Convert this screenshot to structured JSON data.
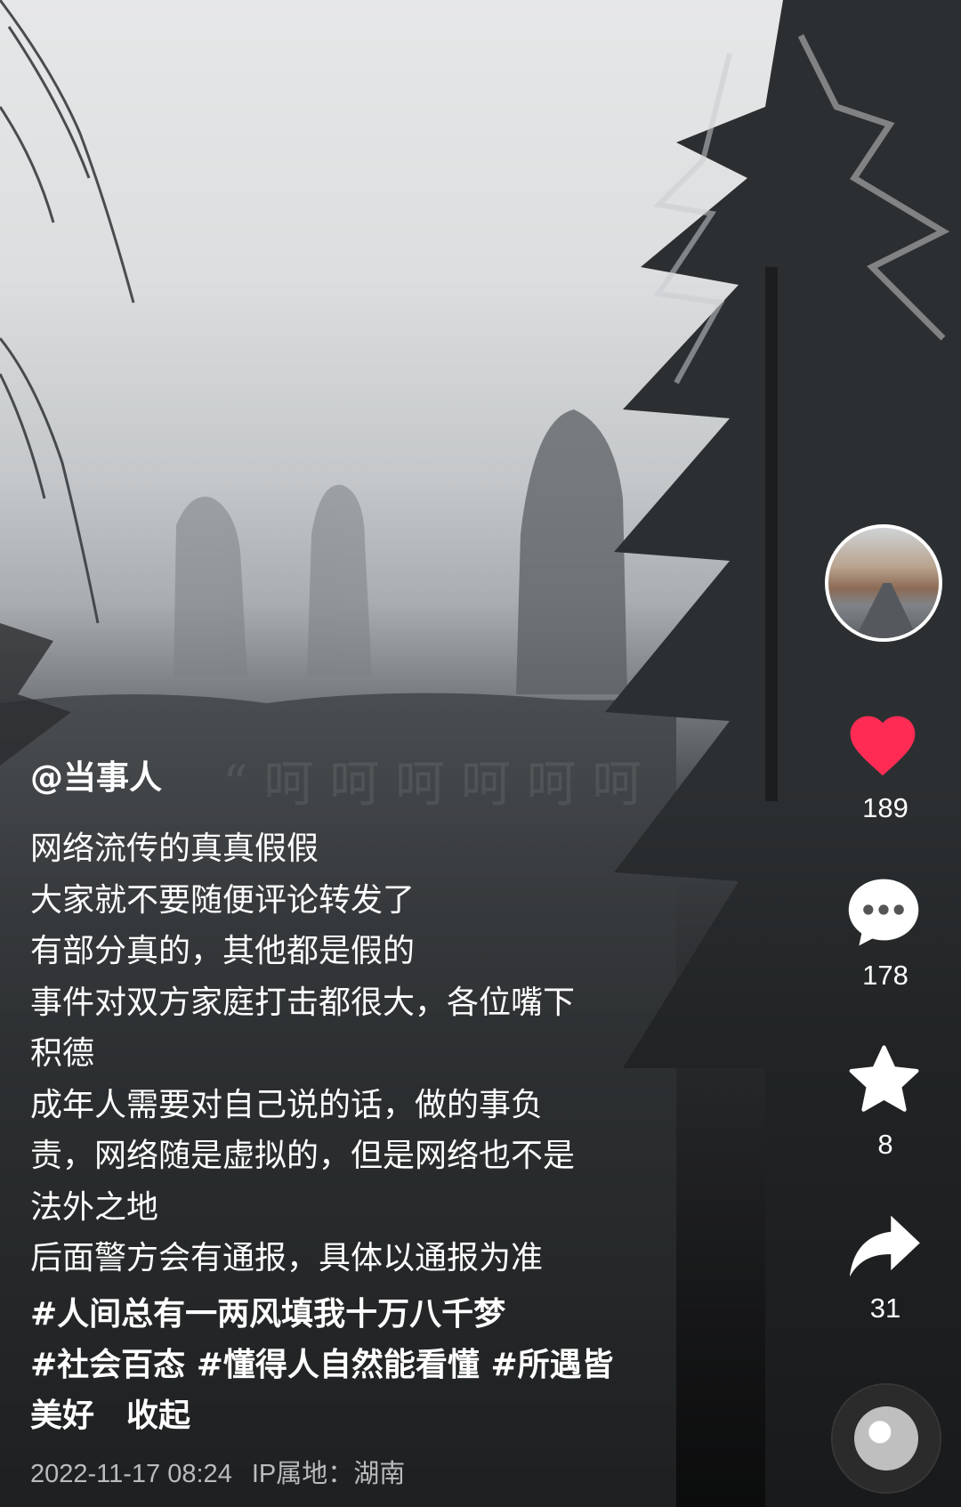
{
  "post": {
    "author": "@当事人",
    "caption_lines": [
      "网络流传的真真假假",
      "大家就不要随便评论转发了",
      "有部分真的，其他都是假的",
      "事件对双方家庭打击都很大，各位嘴下",
      "积德",
      "成年人需要对自己说的话，做的事负",
      "责，网络随是虚拟的，但是网络也不是",
      "法外之地",
      "后面警方会有通报，具体以通报为准"
    ],
    "hashtags": [
      "#人间总有一两风填我十万八千梦",
      "#社会百态",
      "#懂得人自然能看懂",
      "#所遇皆美好"
    ],
    "hashtag_line3_part1": "#所遇皆",
    "hashtag_line3_part2": "美好",
    "collapse_label": "收起",
    "date": "2022-11-17 08:24",
    "ip_location": "IP属地：湖南"
  },
  "actions": {
    "likes": "189",
    "comments": "178",
    "favorites": "8",
    "shares": "31"
  },
  "icons": {
    "like": "heart-icon",
    "comment": "comment-bubble-icon",
    "favorite": "star-icon",
    "share": "share-arrow-icon",
    "music": "music-disc-icon"
  },
  "colors": {
    "like_red": "#fe2c55",
    "text": "#ffffff",
    "meta_text": "#b9bbbd"
  }
}
